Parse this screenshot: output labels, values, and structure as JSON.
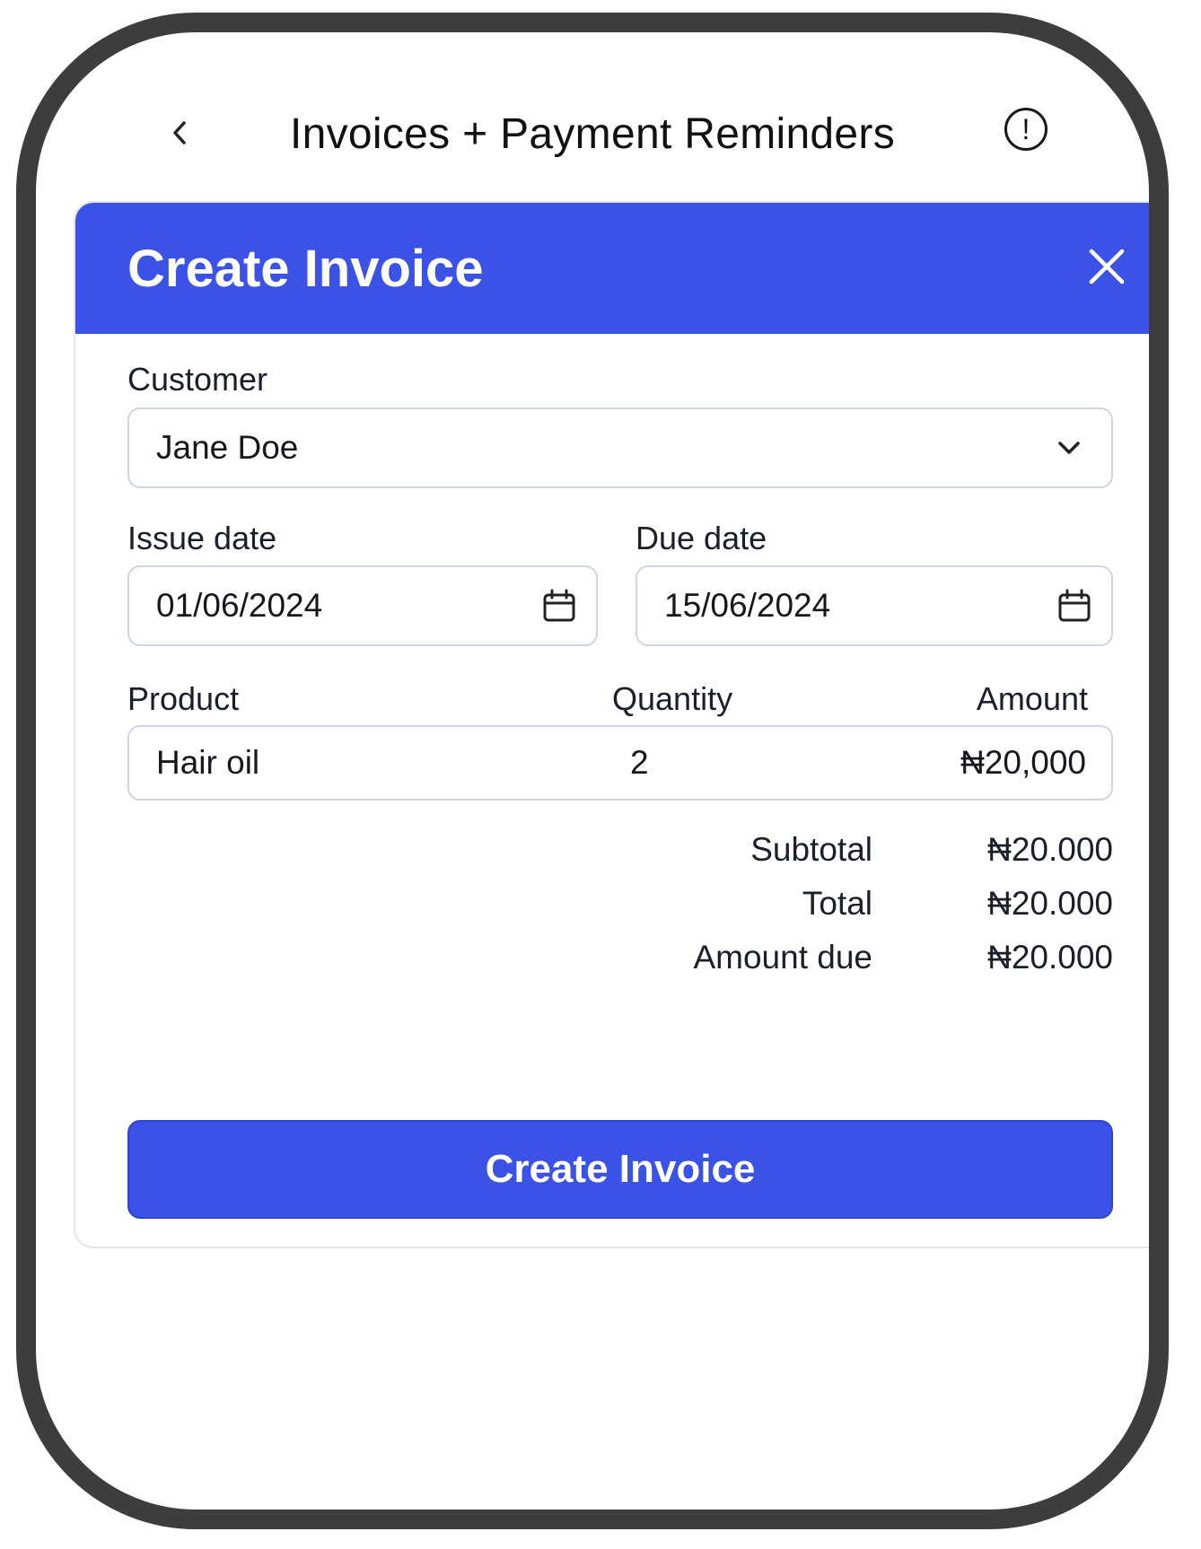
{
  "header": {
    "title": "Invoices + Payment Reminders",
    "back_icon": "chevron-left-icon",
    "info_icon": "exclamation-circle-icon",
    "info_glyph": "!"
  },
  "modal": {
    "title": "Create Invoice",
    "close_icon": "close-icon",
    "accent_color": "#3a52e5",
    "customer": {
      "label": "Customer",
      "value": "Jane Doe",
      "icon": "chevron-down-icon"
    },
    "issue_date": {
      "label": "Issue date",
      "value": "01/06/2024",
      "icon": "calendar-icon"
    },
    "due_date": {
      "label": "Due date",
      "value": "15/06/2024",
      "icon": "calendar-icon"
    },
    "line_items": {
      "headers": {
        "product": "Product",
        "quantity": "Quantity",
        "amount": "Amount"
      },
      "rows": [
        {
          "product": "Hair oil",
          "quantity": "2",
          "amount": "₦20,000"
        }
      ]
    },
    "totals": {
      "subtotal_label": "Subtotal",
      "subtotal_value": "₦20.000",
      "total_label": "Total",
      "total_value": "₦20.000",
      "amount_due_label": "Amount due",
      "amount_due_value": "₦20.000"
    },
    "submit_label": "Create Invoice"
  }
}
